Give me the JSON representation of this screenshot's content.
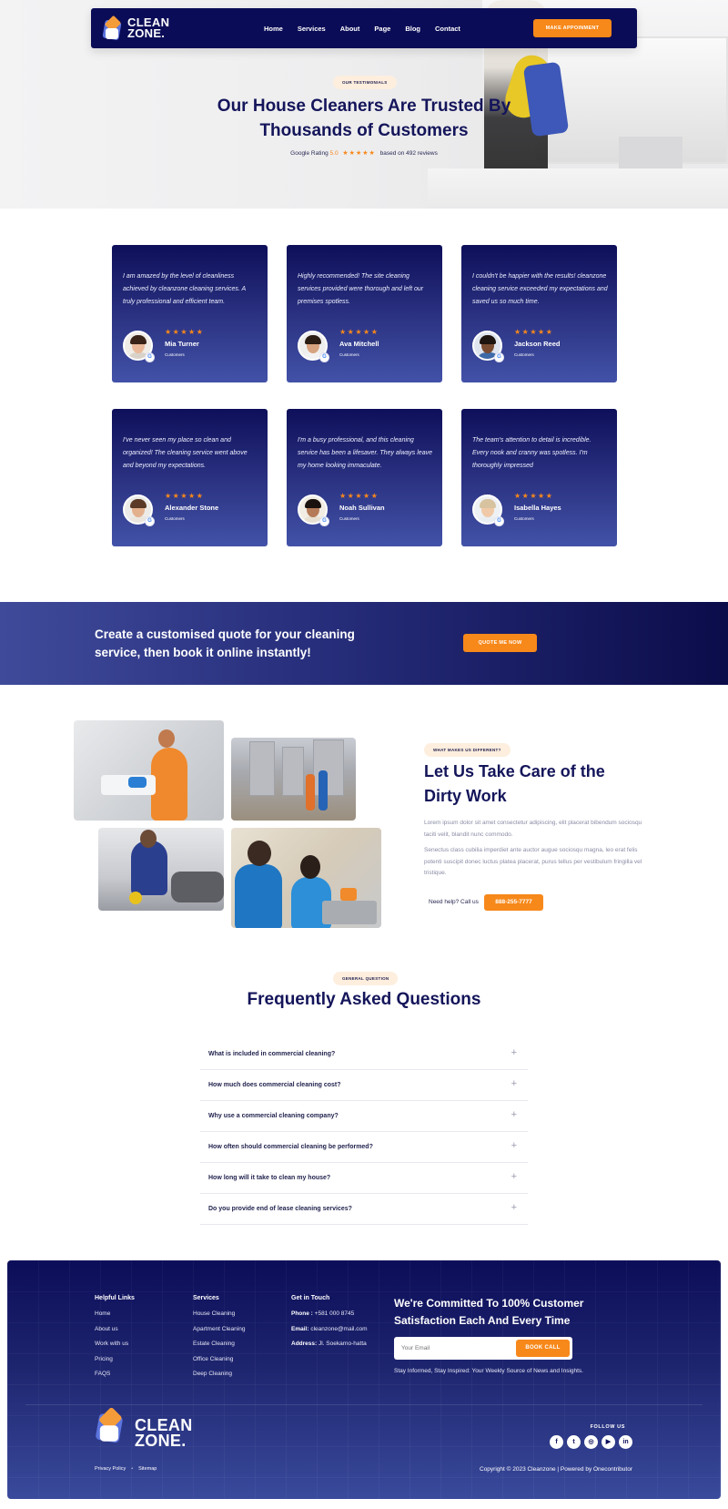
{
  "brand": {
    "name_line1": "CLEAN",
    "name_line2": "ZONE."
  },
  "nav": {
    "items": [
      "Home",
      "Services",
      "About",
      "Page",
      "Blog",
      "Contact"
    ],
    "cta": "MAKE APPOINMENT"
  },
  "hero": {
    "pill": "OUR TESTIMONIALS",
    "title": "Our House Cleaners Are Trusted By Thousands of Customers",
    "rating_prefix": "Google Rating",
    "rating_score": "5.0",
    "stars": "★★★★★",
    "rating_suffix": "based on 492 reviews"
  },
  "testimonials": [
    {
      "quote": "I am amazed by the level of cleanliness achieved by cleanzone cleaning services. A truly professional and efficient team.",
      "name": "Mia Turner",
      "role": "Customers",
      "stars": "★★★★★"
    },
    {
      "quote": "Highly recommended! The site cleaning services provided were thorough and left our premises spotless.",
      "name": "Ava Mitchell",
      "role": "Customers",
      "stars": "★★★★★"
    },
    {
      "quote": "I couldn't be happier with the results! cleanzone cleaning service exceeded my expectations and saved us so much time.",
      "name": "Jackson Reed",
      "role": "Customers",
      "stars": "★★★★★"
    },
    {
      "quote": "I've never seen my place so clean and organized! The cleaning service went above and beyond my expectations.",
      "name": "Alexander Stone",
      "role": "Customers",
      "stars": "★★★★★"
    },
    {
      "quote": "I'm a busy professional, and this cleaning service has been a lifesaver. They always leave my home looking immaculate.",
      "name": "Noah Sullivan",
      "role": "Customers",
      "stars": "★★★★★"
    },
    {
      "quote": "The team's attention to detail is incredible. Every nook and cranny was spotless. I'm thoroughly impressed",
      "name": "Isabella Hayes",
      "role": "Customers",
      "stars": "★★★★★"
    }
  ],
  "cta_band": {
    "text": "Create a customised quote for your cleaning service, then book it online instantly!",
    "button": "QUOTE ME NOW"
  },
  "about": {
    "pill": "WHAT MAKES US DIFFERENT?",
    "title": "Let Us Take Care of the Dirty Work",
    "p1": "Lorem ipsum dolor sit amet consectetur adipiscing, elit placerat bibendum sociosqu taciti velit, blandit nunc commodo.",
    "p2": "Senectus class cubilia imperdiet ante auctor augue sociosqu magna, leo erat felis potenti suscipit donec luctus platea placerat, purus tellus per vestibulum fringilla vel tristique.",
    "help_text": "Need help? Call us",
    "phone": "888-255-7777"
  },
  "faq": {
    "pill": "GENERAL QUESTION",
    "title": "Frequently Asked Questions",
    "questions": [
      "What is included in commercial cleaning?",
      "How much does commercial cleaning cost?",
      "Why use a commercial cleaning company?",
      "How often should commercial cleaning be performed?",
      "How long will it take to clean my house?",
      "Do you provide end of lease cleaning services?"
    ]
  },
  "footer": {
    "helpful_links": {
      "heading": "Helpful Links",
      "items": [
        "Home",
        "About us",
        "Work with us",
        "Pricing",
        "FAQS"
      ]
    },
    "services": {
      "heading": "Services",
      "items": [
        "House Cleaning",
        "Apartment Cleaning",
        "Estate Cleaning",
        "Office Cleaning",
        "Deep Cleaning"
      ]
    },
    "contact": {
      "heading": "Get in Touch",
      "phone_label": "Phone :",
      "phone": "+581 000 8745",
      "email_label": "Email:",
      "email": "cleanzone@mail.com",
      "address_label": "Address:",
      "address": "Jl. Soekarno-hatta"
    },
    "commit": "We're Committed To 100% Customer Satisfaction Each And Every Time",
    "email_placeholder": "Your Email",
    "book_call": "BOOK CALL",
    "newsletter_note": "Stay Informed, Stay Inspired: Your Weekly Source of News and Insights.",
    "privacy": "Privacy Policy",
    "sitemap": "Sitemap",
    "follow": "FOLLOW US",
    "social": [
      {
        "icon": "facebook-icon",
        "glyph": "f"
      },
      {
        "icon": "twitter-icon",
        "glyph": "t"
      },
      {
        "icon": "instagram-icon",
        "glyph": "◎"
      },
      {
        "icon": "youtube-icon",
        "glyph": "▶"
      },
      {
        "icon": "linkedin-icon",
        "glyph": "in"
      }
    ],
    "copyright": "Copyright © 2023 Cleanzone | Powered by Onecontributor"
  },
  "colors": {
    "navy": "#0b0c57",
    "accent": "#f7881a",
    "pill": "#fdeede"
  }
}
